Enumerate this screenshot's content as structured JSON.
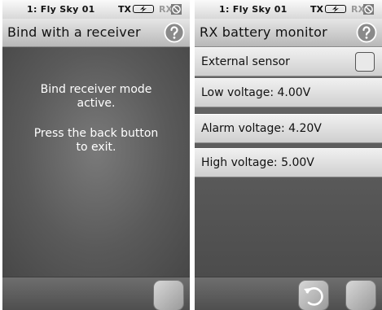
{
  "left": {
    "status": {
      "model": "1: Fly Sky 01",
      "tx": "TX",
      "rx": "RX"
    },
    "title": "Bind with a receiver",
    "message_line1": "Bind receiver mode",
    "message_line2": "active.",
    "message_line3": "Press the back button",
    "message_line4": "to exit."
  },
  "right": {
    "status": {
      "model": "1: Fly Sky 01",
      "tx": "TX",
      "rx": "RX"
    },
    "title": "RX battery monitor",
    "rows": [
      {
        "label": "External sensor",
        "checked": false
      },
      {
        "label": "Low voltage: 4.00V"
      },
      {
        "label": "Alarm voltage: 4.20V"
      },
      {
        "label": "High voltage: 5.00V"
      }
    ]
  },
  "icons": {
    "help": "question-mark-icon",
    "battery": "battery-icon",
    "no_signal": "no-signal-icon",
    "back": "back-arrow-icon"
  }
}
